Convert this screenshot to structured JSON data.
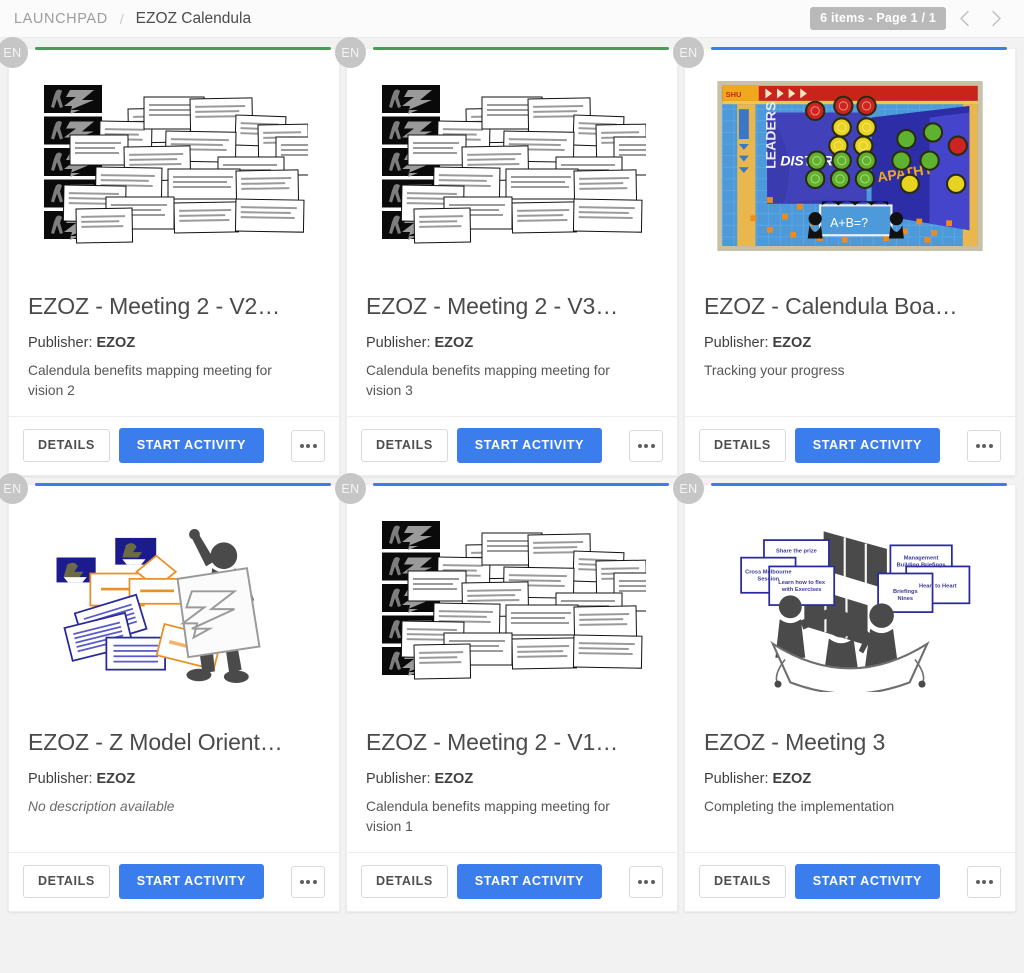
{
  "header": {
    "breadcrumb_root": "LAUNCHPAD",
    "breadcrumb_separator": "/",
    "breadcrumb_current": "EZOZ Calendula",
    "page_chip": "6 items - Page 1 / 1",
    "prev_icon": "chevron-left-icon",
    "next_icon": "chevron-right-icon"
  },
  "labels": {
    "details": "DETAILS",
    "start_activity": "START ACTIVITY",
    "more": "more-options-icon",
    "language_badge": "EN",
    "publisher_prefix": "Publisher:"
  },
  "colors": {
    "accent_blue": "#3b7ded",
    "accent_green": "#4a9c5b",
    "page_background": "#f2f2f2",
    "card_background": "#ffffff",
    "badge_gray": "#c6c6c6",
    "chip_gray": "#b9b9b9"
  },
  "cards": [
    {
      "lang": "EN",
      "accent": "#4a9c5b",
      "title": "EZOZ - Meeting 2 - V2…",
      "publisher_prefix": "Publisher:",
      "publisher": "EZOZ",
      "description": "Calendula benefits mapping meeting for vision 2",
      "description_missing": false,
      "thumbnail": "sticky-notes-board",
      "details": "DETAILS",
      "start": "START ACTIVITY"
    },
    {
      "lang": "EN",
      "accent": "#4a9c5b",
      "title": "EZOZ - Meeting 2 - V3…",
      "publisher_prefix": "Publisher:",
      "publisher": "EZOZ",
      "description": "Calendula benefits mapping meeting for vision 3",
      "description_missing": false,
      "thumbnail": "sticky-notes-board",
      "details": "DETAILS",
      "start": "START ACTIVITY"
    },
    {
      "lang": "EN",
      "accent": "#3b7ded",
      "title": "EZOZ - Calendula Boa…",
      "publisher_prefix": "Publisher:",
      "publisher": "EZOZ",
      "description": "Tracking your progress",
      "description_missing": false,
      "thumbnail": "game-board",
      "details": "DETAILS",
      "start": "START ACTIVITY"
    },
    {
      "lang": "EN",
      "accent": "#3b7ded",
      "title": "EZOZ - Z Model Orient…",
      "publisher_prefix": "Publisher:",
      "publisher": "EZOZ",
      "description": "No description available",
      "description_missing": true,
      "thumbnail": "presenter-figure",
      "details": "DETAILS",
      "start": "START ACTIVITY"
    },
    {
      "lang": "EN",
      "accent": "#3b7ded",
      "title": "EZOZ - Meeting 2 - V1…",
      "publisher_prefix": "Publisher:",
      "publisher": "EZOZ",
      "description": "Calendula benefits mapping meeting for vision 1",
      "description_missing": false,
      "thumbnail": "sticky-notes-board",
      "details": "DETAILS",
      "start": "START ACTIVITY"
    },
    {
      "lang": "EN",
      "accent": "#3b7ded",
      "title": "EZOZ - Meeting 3",
      "publisher_prefix": "Publisher:",
      "publisher": "EZOZ",
      "description": "Completing the implementation",
      "description_missing": false,
      "thumbnail": "boat-team",
      "details": "DETAILS",
      "start": "START ACTIVITY"
    }
  ]
}
